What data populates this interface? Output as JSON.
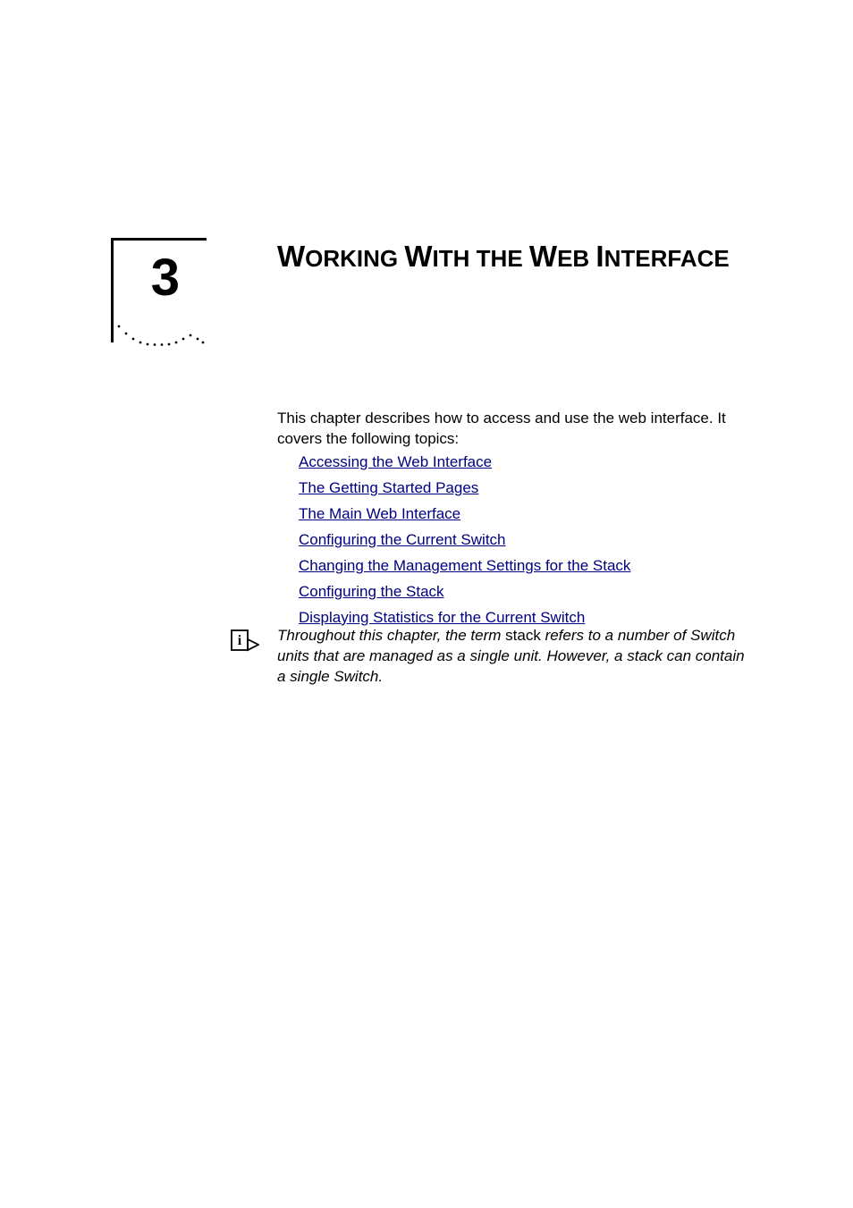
{
  "chapter": {
    "number": "3",
    "title_parts": [
      {
        "lead": "W",
        "rest": "ORKING"
      },
      {
        "lead": "W",
        "rest": "ITH"
      },
      {
        "lead": "",
        "rest": "THE"
      },
      {
        "lead": "W",
        "rest": "EB"
      },
      {
        "lead": "I",
        "rest": "NTERFACE"
      }
    ]
  },
  "intro": "This chapter describes how to access and use the web interface. It covers the following topics:",
  "topics": [
    "Accessing the Web Interface",
    "The Getting Started Pages",
    "The Main Web Interface",
    "Configuring the Current Switch",
    "Changing the Management Settings for the Stack",
    "Configuring the Stack",
    "Displaying Statistics for the Current Switch"
  ],
  "note": {
    "pre": "Throughout this chapter, the term ",
    "term": "stack",
    "post": " refers to a number of Switch units that are managed as a single unit. However, a stack can contain a single Switch."
  },
  "colors": {
    "link": "#000080"
  }
}
